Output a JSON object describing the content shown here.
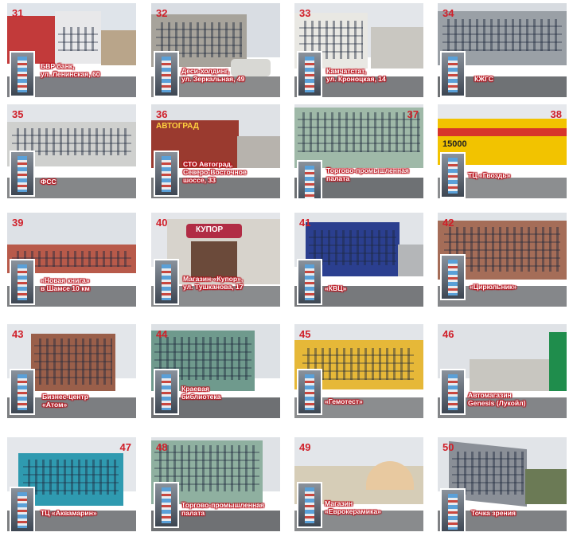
{
  "tiles": [
    {
      "number": "31",
      "caption": "БВР банк,\nул. Ленинская, 60"
    },
    {
      "number": "32",
      "caption": "Деси-холдинг,\nул. Зеркальная, 49"
    },
    {
      "number": "33",
      "caption": "Камчатстат,\nул. Кроноцкая, 14"
    },
    {
      "number": "34",
      "caption": "КЖГС"
    },
    {
      "number": "35",
      "caption": "ФСС"
    },
    {
      "number": "36",
      "caption": "СТО Автоград,\nСеверо-Восточное\nшоссе, 33"
    },
    {
      "number": "37",
      "caption": "Торгово-промышленная\nпалата"
    },
    {
      "number": "38",
      "caption": "ТЦ «Гвоздь»"
    },
    {
      "number": "39",
      "caption": "«Новая книга»\nв Шамсе 10 км"
    },
    {
      "number": "40",
      "caption": "Магазин «Купор»,\nул. Тушканова, 17"
    },
    {
      "number": "41",
      "caption": "«КВЦ»"
    },
    {
      "number": "42",
      "caption": "«Цирюльник»"
    },
    {
      "number": "43",
      "caption": "Бизнес-центр\n«Атом»"
    },
    {
      "number": "44",
      "caption": "Краевая\nбиблиотека"
    },
    {
      "number": "45",
      "caption": "«Гемотест»"
    },
    {
      "number": "46",
      "caption": "Автомагазин\nGenesis (Лукойл)"
    },
    {
      "number": "47",
      "caption": "ТЦ «Аквамарин»"
    },
    {
      "number": "48",
      "caption": "Торгово-промышленная\nпалата"
    },
    {
      "number": "49",
      "caption": "Магазин\n«Еврокерамика»"
    },
    {
      "number": "50",
      "caption": "Точка зрения"
    }
  ],
  "signs": {
    "t36": "АВТОГРАД",
    "t38_price": "15000",
    "t40": "КУПОР"
  }
}
